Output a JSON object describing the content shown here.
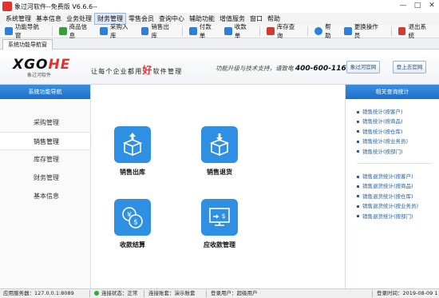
{
  "window": {
    "title": "象过河软件--免费版 V6.6.6--"
  },
  "menu": [
    "系统管理",
    "基本信息",
    "业务处理",
    "财务管理",
    "零售会员",
    "查询中心",
    "辅助功能",
    "增值服务",
    "窗口",
    "帮助"
  ],
  "toolbar": [
    {
      "label": "功能导航窗",
      "icon": "home-icon",
      "color": "#2f7fd6"
    },
    {
      "label": "商品信息",
      "icon": "product-icon",
      "color": "#3a9d3a"
    },
    {
      "label": "采购入库",
      "icon": "purchase-in-icon",
      "color": "#2f7fd6"
    },
    {
      "label": "销售出库",
      "icon": "sales-out-icon",
      "color": "#2f7fd6"
    },
    {
      "label": "付款单",
      "icon": "payment-icon",
      "color": "#2f7fd6"
    },
    {
      "label": "收款单",
      "icon": "receipt-icon",
      "color": "#2f7fd6"
    },
    {
      "label": "库存查询",
      "icon": "inventory-icon",
      "color": "#d03a2f"
    },
    {
      "label": "帮助",
      "icon": "help-icon",
      "color": "#2f7fd6"
    },
    {
      "label": "更换操作员",
      "icon": "switch-user-icon",
      "color": "#2f7fd6"
    },
    {
      "label": "退出系统",
      "icon": "exit-icon",
      "color": "#d03a2f"
    }
  ],
  "doc_tab": "系统功能导航窗",
  "banner": {
    "logo_left": "XGO",
    "logo_right": "HE",
    "logo_sub": "象过河软件",
    "slogan_pre": "让每个企业都用",
    "slogan_big": "好",
    "slogan_post": "软件管理",
    "hotline_text": "功能升级与技术支持，请致电",
    "hotline_number": "400-600-1168",
    "btn_official": "象过河官网",
    "btn_forum": "登上去官网"
  },
  "leftnav": {
    "header": "系统功能导航",
    "items": [
      "采购管理",
      "销售管理",
      "库存管理",
      "财务管理",
      "基本信息"
    ],
    "active_index": 1
  },
  "main": {
    "tiles": [
      {
        "label": "销售出库",
        "icon": "box-out-icon"
      },
      {
        "label": "销售退货",
        "icon": "box-return-icon"
      },
      {
        "label": "收款结算",
        "icon": "coins-icon"
      },
      {
        "label": "应收款管理",
        "icon": "monitor-money-icon"
      }
    ]
  },
  "rightpanel": {
    "header": "相关查询统计",
    "group1": [
      "销售统计(按客户)",
      "销售统计(按商品)",
      "销售统计(按仓库)",
      "销售统计(按业务员)",
      "销售统计(按部门)"
    ],
    "group2": [
      "销售退货统计(按客户)",
      "销售退货统计(按商品)",
      "销售退货统计(按仓库)",
      "销售退货统计(按业务员)",
      "销售退货统计(按部门)"
    ]
  },
  "status": {
    "server": "应用服务器：127.0.0.1:8089",
    "connection": "连接状态：正常",
    "account": "连接账套：演示账套",
    "user": "登录用户：超级用户",
    "login_time": "登录时间：2019-08-09 1"
  },
  "colors": {
    "accent_blue": "#2f8fe3",
    "brand_red": "#e5312b",
    "link_blue": "#1f5fa8"
  }
}
